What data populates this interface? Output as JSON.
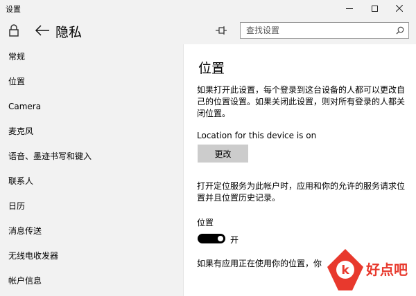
{
  "window": {
    "title": "设置"
  },
  "header": {
    "title": "隐私",
    "search_placeholder": "查找设置"
  },
  "sidebar": {
    "items": [
      {
        "label": "常规"
      },
      {
        "label": "位置"
      },
      {
        "label": "Camera"
      },
      {
        "label": "麦克风"
      },
      {
        "label": "语音、墨迹书写和键入"
      },
      {
        "label": "联系人"
      },
      {
        "label": "日历"
      },
      {
        "label": "消息传送"
      },
      {
        "label": "无线电收发器"
      },
      {
        "label": "帐户信息"
      }
    ]
  },
  "main": {
    "title": "位置",
    "desc1": "如果打开此设置，每个登录到这台设备的人都可以更改自己的位置设置。如果关闭此设置，则对所有登录的人都关闭位置。",
    "status": "Location for this device is on",
    "change_label": "更改",
    "desc2": "打开定位服务为此帐户时，应用和你的允许的服务请求位置并且位置历史记录。",
    "toggle_label": "位置",
    "toggle_state": "开",
    "toggle_on": true,
    "desc3": "如果有应用正在使用你的位置，你"
  },
  "watermark": {
    "text": "好点吧"
  },
  "colors": {
    "sidebar_bg": "#f2f2f2",
    "button_bg": "#cccccc",
    "watermark_red": "#e8392d"
  }
}
